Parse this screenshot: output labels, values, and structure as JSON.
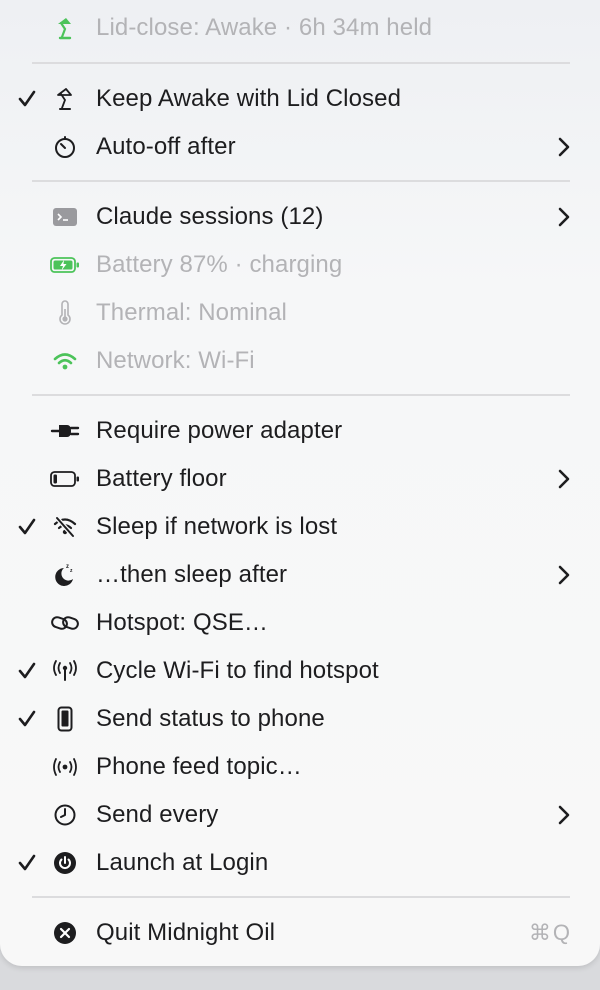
{
  "menu": {
    "status_line": "Lid-close: Awake · 6h 34m held",
    "keep_awake": "Keep Awake with Lid Closed",
    "auto_off": "Auto-off after",
    "claude_sessions": "Claude sessions (12)",
    "battery_status": "Battery 87% · charging",
    "thermal_status": "Thermal: Nominal",
    "network_status": "Network: Wi-Fi",
    "require_power": "Require power adapter",
    "battery_floor": "Battery floor",
    "sleep_network_lost": "Sleep if network is lost",
    "then_sleep_after": "…then sleep after",
    "hotspot": "Hotspot: QSE…",
    "cycle_wifi": "Cycle Wi-Fi to find hotspot",
    "send_status": "Send status to phone",
    "phone_feed": "Phone feed topic…",
    "send_every": "Send every",
    "launch_login": "Launch at Login",
    "quit": "Quit Midnight Oil",
    "quit_shortcut": "⌘Q"
  },
  "colors": {
    "text": "#1d1d1f",
    "disabled_text": "#b3b3b6",
    "green": "#4cc35a",
    "separator": "#dcdcde"
  },
  "icons": {
    "status_line": "desk-lamp-icon",
    "keep_awake": "desk-lamp-icon",
    "auto_off": "timer-icon",
    "claude_sessions": "terminal-icon",
    "battery_status": "battery-charging-icon",
    "thermal_status": "thermometer-icon",
    "network_status": "wifi-icon",
    "require_power": "power-plug-icon",
    "battery_floor": "battery-low-icon",
    "sleep_network_lost": "wifi-off-icon",
    "then_sleep_after": "moon-zzz-icon",
    "hotspot": "link-icon",
    "cycle_wifi": "antenna-icon",
    "send_status": "phone-icon",
    "phone_feed": "broadcast-icon",
    "send_every": "clock-icon",
    "launch_login": "power-icon",
    "quit": "close-circle-icon"
  }
}
